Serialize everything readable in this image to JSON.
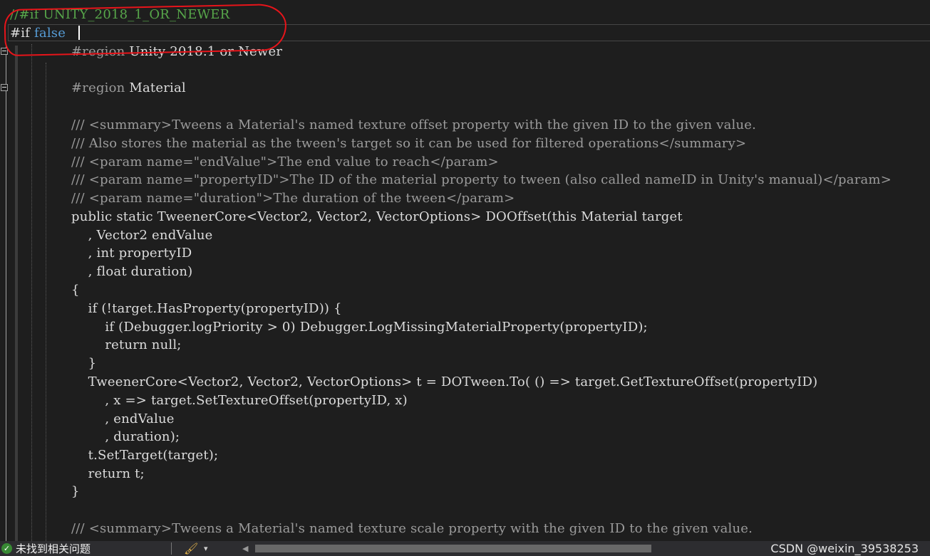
{
  "code": {
    "line_01_comment": "//#if UNITY_2018_1_OR_NEWER",
    "line_02_directive": "#if",
    "line_02_keyword": "false",
    "line_03_directive": "#region",
    "line_03_text": "Unity 2018.1 or Newer",
    "line_05_directive": "#region",
    "line_05_text": "Material",
    "line_07": "/// <summary>Tweens a Material's named texture offset property with the given ID to the given value.",
    "line_08": "/// Also stores the material as the tween's target so it can be used for filtered operations</summary>",
    "line_09": "/// <param name=\"endValue\">The end value to reach</param>",
    "line_10": "/// <param name=\"propertyID\">The ID of the material property to tween (also called nameID in Unity's manual)</param>",
    "line_11": "/// <param name=\"duration\">The duration of the tween</param>",
    "line_12": "public static TweenerCore<Vector2, Vector2, VectorOptions> DOOffset(this Material target",
    "line_13": "    , Vector2 endValue",
    "line_14": "    , int propertyID",
    "line_15": "    , float duration)",
    "line_16": "{",
    "line_17": "    if (!target.HasProperty(propertyID)) {",
    "line_18": "        if (Debugger.logPriority > 0) Debugger.LogMissingMaterialProperty(propertyID);",
    "line_19": "        return null;",
    "line_20": "    }",
    "line_21": "    TweenerCore<Vector2, Vector2, VectorOptions> t = DOTween.To( () => target.GetTextureOffset(propertyID)",
    "line_22": "        , x => target.SetTextureOffset(propertyID, x)",
    "line_23": "        , endValue",
    "line_24": "        , duration);",
    "line_25": "    t.SetTarget(target);",
    "line_26": "    return t;",
    "line_27": "}",
    "line_29": "/// <summary>Tweens a Material's named texture scale property with the given ID to the given value."
  },
  "status": {
    "issues_text": "未找到相关问题",
    "check_icon": "✓",
    "brush_icon": "🖌",
    "dropdown_icon": "▾",
    "scroll_left_icon": "◀"
  },
  "watermark": "CSDN @weixin_39538253",
  "colors": {
    "background": "#1e1e1e",
    "comment": "#57a64a",
    "keyword": "#569cd6",
    "annotation": "#e8141a"
  }
}
